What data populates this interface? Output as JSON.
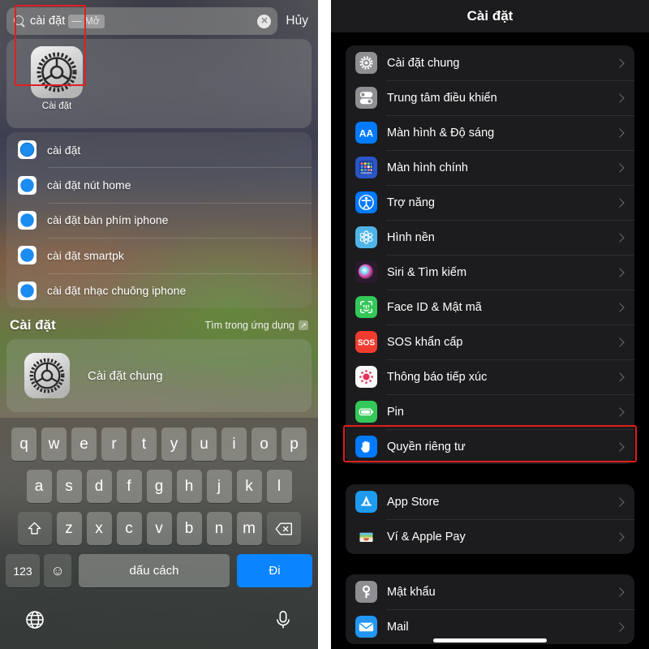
{
  "left": {
    "search": {
      "query": "cài đặt",
      "completion": "— Mở",
      "clear_label": "✕",
      "cancel_label": "Hủy",
      "icon": "search-icon"
    },
    "top_app": {
      "label": "Cài đặt",
      "icon": "settings-gear-icon",
      "highlighted": true,
      "highlight_color": "#e02020"
    },
    "suggestions": [
      {
        "icon": "safari-icon",
        "label": "cài đặt"
      },
      {
        "icon": "safari-icon",
        "label": "cài đặt nút home"
      },
      {
        "icon": "safari-icon",
        "label": "cài đặt bàn phím iphone"
      },
      {
        "icon": "safari-icon",
        "label": "cài đặt smartpk"
      },
      {
        "icon": "safari-icon",
        "label": "cài đặt nhạc chuông iphone"
      }
    ],
    "section": {
      "title": "Cài đặt",
      "action_label": "Tìm trong ứng dụng",
      "action_icon": "external-link-icon",
      "action_glyph": "↗"
    },
    "result": {
      "icon": "settings-gear-icon",
      "label": "Cài đặt chung"
    },
    "keyboard": {
      "row1": [
        "q",
        "w",
        "e",
        "r",
        "t",
        "y",
        "u",
        "i",
        "o",
        "p"
      ],
      "row2": [
        "a",
        "s",
        "d",
        "f",
        "g",
        "h",
        "j",
        "k",
        "l"
      ],
      "row3": [
        "z",
        "x",
        "c",
        "v",
        "b",
        "n",
        "m"
      ],
      "shift_icon": "shift-up-arrow-icon",
      "backspace_icon": "backspace-delete-icon",
      "numbers_label": "123",
      "emoji_icon": "smiley-face-icon",
      "emoji_glyph": "☺",
      "space_label": "dấu cách",
      "go_label": "Đi",
      "go_color": "#0a84ff",
      "globe_icon": "globe-language-icon",
      "mic_icon": "microphone-icon"
    }
  },
  "right": {
    "nav": {
      "title": "Cài đặt"
    },
    "groups": [
      {
        "name": "primary-settings-group",
        "rows": [
          {
            "icon": "gear-icon",
            "icon_color": "#8e8e93",
            "label": "Cài đặt chung",
            "highlighted": false
          },
          {
            "icon": "control-center-icon",
            "icon_color": "#8e8e93",
            "label": "Trung tâm điều khiển",
            "highlighted": false
          },
          {
            "icon": "display-aa-icon",
            "icon_color": "#007aff",
            "label": "Màn hình & Độ sáng",
            "highlighted": false
          },
          {
            "icon": "home-screen-icon",
            "icon_color": "#2b56c8",
            "label": "Màn hình chính",
            "highlighted": false
          },
          {
            "icon": "accessibility-icon",
            "icon_color": "#007aff",
            "label": "Trợ năng",
            "highlighted": false
          },
          {
            "icon": "wallpaper-icon",
            "icon_color": "#4fb5e8",
            "label": "Hình nền",
            "highlighted": false
          },
          {
            "icon": "siri-icon",
            "icon_color": "#2b1b2e",
            "label": "Siri & Tìm kiếm",
            "highlighted": false
          },
          {
            "icon": "face-id-icon",
            "icon_color": "#34c759",
            "label": "Face ID & Mật mã",
            "highlighted": false
          },
          {
            "icon": "sos-icon",
            "icon_color": "#f03c30",
            "label": "SOS khẩn cấp",
            "highlighted": false
          },
          {
            "icon": "exposure-notification-icon",
            "icon_color": "#ffffff",
            "label": "Thông báo tiếp xúc",
            "highlighted": false
          },
          {
            "icon": "battery-icon",
            "icon_color": "#34c759",
            "label": "Pin",
            "highlighted": false
          },
          {
            "icon": "privacy-hand-icon",
            "icon_color": "#007aff",
            "label": "Quyền riêng tư",
            "highlighted": true
          }
        ]
      },
      {
        "name": "store-group",
        "rows": [
          {
            "icon": "app-store-icon",
            "icon_color": "#1e9bf0",
            "label": "App Store",
            "highlighted": false
          },
          {
            "icon": "wallet-icon",
            "icon_color": "#1c1c1e",
            "label": "Ví & Apple Pay",
            "highlighted": false
          }
        ]
      },
      {
        "name": "accounts-group",
        "rows": [
          {
            "icon": "key-icon",
            "icon_color": "#8e8e93",
            "label": "Mật khẩu",
            "highlighted": false
          },
          {
            "icon": "mail-icon",
            "icon_color": "#1e9bf0",
            "label": "Mail",
            "highlighted": false
          }
        ]
      }
    ],
    "highlight_color": "#e02020"
  }
}
